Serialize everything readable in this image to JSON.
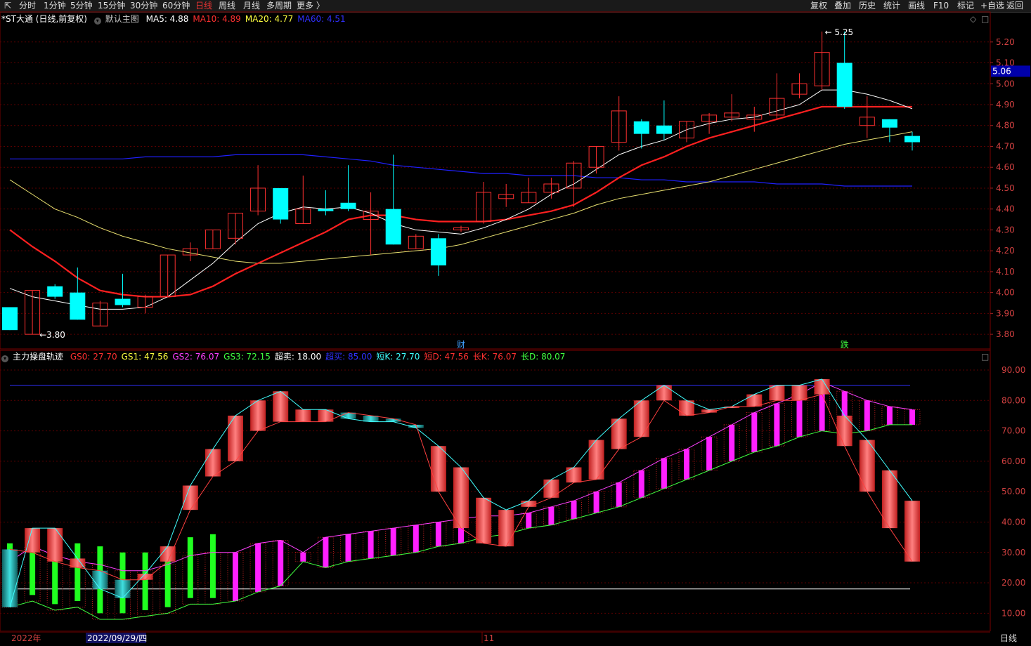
{
  "toolbar": {
    "periods": [
      "分时",
      "1分钟",
      "5分钟",
      "15分钟",
      "30分钟",
      "60分钟",
      "日线",
      "周线",
      "月线",
      "多周期",
      "更多 〉"
    ],
    "active_period": "日线",
    "right_buttons": [
      "复权",
      "叠加",
      "历史",
      "统计",
      "画线",
      "F10",
      "标记",
      "+自选",
      "返回"
    ]
  },
  "main_panel": {
    "stock_title": "*ST大通 (日线,前复权)",
    "template": "默认主图",
    "ma": [
      {
        "label": "MA5: 4.88",
        "color": "#ffffff"
      },
      {
        "label": "MA10: 4.89",
        "color": "#ff3030"
      },
      {
        "label": "MA20: 4.77",
        "color": "#ffff40"
      },
      {
        "label": "MA60: 4.51",
        "color": "#3030ff"
      }
    ],
    "price_axis": [
      "5.20",
      "5.10",
      "5.00",
      "4.90",
      "4.80",
      "4.70",
      "4.60",
      "4.50",
      "4.40",
      "4.30",
      "4.20",
      "4.10",
      "4.00",
      "3.90",
      "3.80"
    ],
    "current_price": "5.06",
    "high_label": "5.25",
    "low_label": "3.80",
    "event_labels": [
      {
        "text": "财",
        "color": "#40a0ff"
      },
      {
        "text": "跌",
        "color": "#40ff40"
      }
    ]
  },
  "sub_panel": {
    "title": "主力操盘轨迹",
    "indicators": [
      {
        "label": "GS0: 27.70",
        "color": "#ff3030"
      },
      {
        "label": "GS1: 47.56",
        "color": "#ffff40"
      },
      {
        "label": "GS2: 76.07",
        "color": "#ff40ff"
      },
      {
        "label": "GS3: 72.15",
        "color": "#40ff40"
      },
      {
        "label": "超卖: 18.00",
        "color": "#ffffff"
      },
      {
        "label": "超买: 85.00",
        "color": "#3030ff"
      },
      {
        "label": "短K: 27.70",
        "color": "#40ffff"
      },
      {
        "label": "短D: 47.56",
        "color": "#ff3030"
      },
      {
        "label": "长K: 76.07",
        "color": "#ff3030"
      },
      {
        "label": "长D: 80.07",
        "color": "#40ff40"
      }
    ],
    "axis": [
      "90.00",
      "80.00",
      "70.00",
      "60.00",
      "50.00",
      "40.00",
      "30.00",
      "20.00",
      "10.00"
    ]
  },
  "footer": {
    "year_label": "2022年",
    "date_label": "2022/09/29/四",
    "month_label": "11",
    "period_label": "日线"
  },
  "colors": {
    "up": "#ff3030",
    "down": "#00ffff",
    "ma60": "#2020ff",
    "grid": "#5a0000",
    "axis_text": "#d04040"
  },
  "chart_data": {
    "type": "candlestick",
    "price_range": [
      3.76,
      5.28
    ],
    "candles": [
      {
        "o": 3.82,
        "h": 3.92,
        "l": 3.82,
        "c": 3.93,
        "dn": true
      },
      {
        "o": 3.8,
        "h": 4.01,
        "l": 3.8,
        "c": 4.01
      },
      {
        "o": 4.03,
        "h": 4.04,
        "l": 3.97,
        "c": 3.98,
        "dn": true
      },
      {
        "o": 4.0,
        "h": 4.12,
        "l": 3.87,
        "c": 3.87,
        "dn": true
      },
      {
        "o": 3.84,
        "h": 3.96,
        "l": 3.84,
        "c": 3.95
      },
      {
        "o": 3.97,
        "h": 4.09,
        "l": 3.93,
        "c": 3.94,
        "dn": true
      },
      {
        "o": 3.93,
        "h": 3.99,
        "l": 3.9,
        "c": 3.98
      },
      {
        "o": 3.98,
        "h": 4.18,
        "l": 3.98,
        "c": 4.18
      },
      {
        "o": 4.18,
        "h": 4.24,
        "l": 4.15,
        "c": 4.21
      },
      {
        "o": 4.21,
        "h": 4.3,
        "l": 4.21,
        "c": 4.3
      },
      {
        "o": 4.26,
        "h": 4.36,
        "l": 4.23,
        "c": 4.38
      },
      {
        "o": 4.39,
        "h": 4.61,
        "l": 4.37,
        "c": 4.5
      },
      {
        "o": 4.5,
        "h": 4.5,
        "l": 4.33,
        "c": 4.35,
        "dn": true
      },
      {
        "o": 4.33,
        "h": 4.56,
        "l": 4.33,
        "c": 4.4
      },
      {
        "o": 4.4,
        "h": 4.49,
        "l": 4.37,
        "c": 4.39,
        "dn": true
      },
      {
        "o": 4.43,
        "h": 4.61,
        "l": 4.39,
        "c": 4.4,
        "dn": true
      },
      {
        "o": 4.35,
        "h": 4.48,
        "l": 4.18,
        "c": 4.39
      },
      {
        "o": 4.4,
        "h": 4.66,
        "l": 4.23,
        "c": 4.23,
        "dn": true
      },
      {
        "o": 4.21,
        "h": 4.28,
        "l": 4.22,
        "c": 4.27
      },
      {
        "o": 4.26,
        "h": 4.28,
        "l": 4.08,
        "c": 4.13,
        "dn": true
      },
      {
        "o": 4.3,
        "h": 4.32,
        "l": 4.29,
        "c": 4.31
      },
      {
        "o": 4.34,
        "h": 4.53,
        "l": 4.33,
        "c": 4.48
      },
      {
        "o": 4.45,
        "h": 4.52,
        "l": 4.41,
        "c": 4.47
      },
      {
        "o": 4.43,
        "h": 4.55,
        "l": 4.43,
        "c": 4.48
      },
      {
        "o": 4.48,
        "h": 4.55,
        "l": 4.45,
        "c": 4.52
      },
      {
        "o": 4.5,
        "h": 4.63,
        "l": 4.41,
        "c": 4.62
      },
      {
        "o": 4.6,
        "h": 4.7,
        "l": 4.57,
        "c": 4.7
      },
      {
        "o": 4.72,
        "h": 4.94,
        "l": 4.68,
        "c": 4.87
      },
      {
        "o": 4.82,
        "h": 4.83,
        "l": 4.69,
        "c": 4.76,
        "dn": true
      },
      {
        "o": 4.8,
        "h": 4.92,
        "l": 4.73,
        "c": 4.76,
        "dn": true
      },
      {
        "o": 4.74,
        "h": 4.82,
        "l": 4.72,
        "c": 4.82
      },
      {
        "o": 4.82,
        "h": 4.86,
        "l": 4.76,
        "c": 4.85
      },
      {
        "o": 4.84,
        "h": 4.95,
        "l": 4.82,
        "c": 4.86
      },
      {
        "o": 4.83,
        "h": 4.89,
        "l": 4.77,
        "c": 4.85
      },
      {
        "o": 4.85,
        "h": 5.05,
        "l": 4.83,
        "c": 4.93
      },
      {
        "o": 4.95,
        "h": 5.05,
        "l": 4.93,
        "c": 5.0
      },
      {
        "o": 4.99,
        "h": 5.25,
        "l": 4.97,
        "c": 5.15
      },
      {
        "o": 5.1,
        "h": 5.25,
        "l": 4.88,
        "c": 4.89,
        "dn": true
      },
      {
        "o": 4.84,
        "h": 4.94,
        "l": 4.74,
        "c": 4.8
      },
      {
        "o": 4.83,
        "h": 4.83,
        "l": 4.72,
        "c": 4.79,
        "dn": true
      },
      {
        "o": 4.75,
        "h": 4.77,
        "l": 4.68,
        "c": 4.72,
        "dn": true
      }
    ],
    "ma5": [
      4.02,
      3.98,
      3.96,
      3.94,
      3.92,
      3.92,
      3.93,
      3.98,
      4.06,
      4.14,
      4.24,
      4.33,
      4.38,
      4.41,
      4.4,
      4.41,
      4.38,
      4.33,
      4.3,
      4.29,
      4.28,
      4.31,
      4.35,
      4.4,
      4.47,
      4.52,
      4.59,
      4.66,
      4.7,
      4.73,
      4.78,
      4.81,
      4.83,
      4.84,
      4.87,
      4.9,
      4.97,
      4.97,
      4.95,
      4.92,
      4.88
    ],
    "ma10": [
      4.3,
      4.22,
      4.15,
      4.07,
      4.01,
      3.99,
      3.98,
      3.98,
      3.99,
      4.03,
      4.09,
      4.14,
      4.19,
      4.24,
      4.29,
      4.35,
      4.37,
      4.37,
      4.35,
      4.34,
      4.34,
      4.34,
      4.35,
      4.37,
      4.39,
      4.42,
      4.48,
      4.55,
      4.61,
      4.65,
      4.7,
      4.74,
      4.77,
      4.8,
      4.83,
      4.86,
      4.89,
      4.89,
      4.89,
      4.89,
      4.89
    ],
    "ma20": [
      4.54,
      4.47,
      4.4,
      4.36,
      4.31,
      4.27,
      4.24,
      4.21,
      4.19,
      4.17,
      4.15,
      4.14,
      4.14,
      4.15,
      4.16,
      4.17,
      4.18,
      4.19,
      4.2,
      4.21,
      4.23,
      4.26,
      4.29,
      4.32,
      4.35,
      4.38,
      4.42,
      4.45,
      4.47,
      4.49,
      4.51,
      4.53,
      4.56,
      4.59,
      4.62,
      4.65,
      4.68,
      4.71,
      4.73,
      4.75,
      4.77
    ],
    "ma60": [
      4.64,
      4.64,
      4.64,
      4.64,
      4.64,
      4.64,
      4.65,
      4.65,
      4.65,
      4.65,
      4.66,
      4.66,
      4.66,
      4.66,
      4.65,
      4.64,
      4.63,
      4.61,
      4.6,
      4.59,
      4.58,
      4.57,
      4.57,
      4.56,
      4.56,
      4.56,
      4.55,
      4.55,
      4.54,
      4.54,
      4.53,
      4.53,
      4.53,
      4.53,
      4.52,
      4.52,
      4.52,
      4.51,
      4.51,
      4.51,
      4.51
    ],
    "indicator_range": [
      5,
      93
    ],
    "short_kd": [
      [
        12,
        31
      ],
      [
        38,
        30
      ],
      [
        38,
        27
      ],
      [
        28,
        25
      ],
      [
        18,
        24
      ],
      [
        15,
        21
      ],
      [
        23,
        21
      ],
      [
        32,
        27
      ],
      [
        52,
        44
      ],
      [
        64,
        55
      ],
      [
        75,
        60
      ],
      [
        80,
        70
      ],
      [
        83,
        73
      ],
      [
        77,
        73
      ],
      [
        77,
        73
      ],
      [
        74,
        76
      ],
      [
        73,
        75
      ],
      [
        73,
        74
      ],
      [
        71,
        72
      ],
      [
        65,
        50
      ],
      [
        58,
        38
      ],
      [
        48,
        33
      ],
      [
        44,
        32
      ],
      [
        47,
        45
      ],
      [
        54,
        48
      ],
      [
        58,
        53
      ],
      [
        67,
        54
      ],
      [
        74,
        64
      ],
      [
        80,
        68
      ],
      [
        85,
        80
      ],
      [
        80,
        75
      ],
      [
        77,
        76
      ],
      [
        78,
        78
      ],
      [
        82,
        78
      ],
      [
        85,
        80
      ],
      [
        85,
        80
      ],
      [
        87,
        82
      ],
      [
        75,
        65
      ],
      [
        67,
        50
      ],
      [
        57,
        38
      ],
      [
        47,
        27
      ]
    ],
    "long_kd": [
      [
        27,
        12
      ],
      [
        32,
        14
      ],
      [
        29,
        11
      ],
      [
        27,
        12
      ],
      [
        26,
        8
      ],
      [
        24,
        8
      ],
      [
        24,
        9
      ],
      [
        26,
        10
      ],
      [
        29,
        13
      ],
      [
        30,
        13
      ],
      [
        30,
        14
      ],
      [
        33,
        17
      ],
      [
        34,
        19
      ],
      [
        30,
        27
      ],
      [
        35,
        25
      ],
      [
        36,
        27
      ],
      [
        37,
        28
      ],
      [
        38,
        29
      ],
      [
        39,
        30
      ],
      [
        40,
        32
      ],
      [
        41,
        33
      ],
      [
        42,
        35
      ],
      [
        42,
        36
      ],
      [
        43,
        38
      ],
      [
        45,
        39
      ],
      [
        47,
        41
      ],
      [
        50,
        43
      ],
      [
        53,
        45
      ],
      [
        57,
        48
      ],
      [
        61,
        51
      ],
      [
        64,
        54
      ],
      [
        68,
        57
      ],
      [
        72,
        60
      ],
      [
        76,
        63
      ],
      [
        79,
        65
      ],
      [
        82,
        68
      ],
      [
        86,
        70
      ],
      [
        83,
        69
      ],
      [
        80,
        70
      ],
      [
        78,
        72
      ],
      [
        77,
        72
      ]
    ],
    "overbought": 85,
    "oversold": 18
  }
}
